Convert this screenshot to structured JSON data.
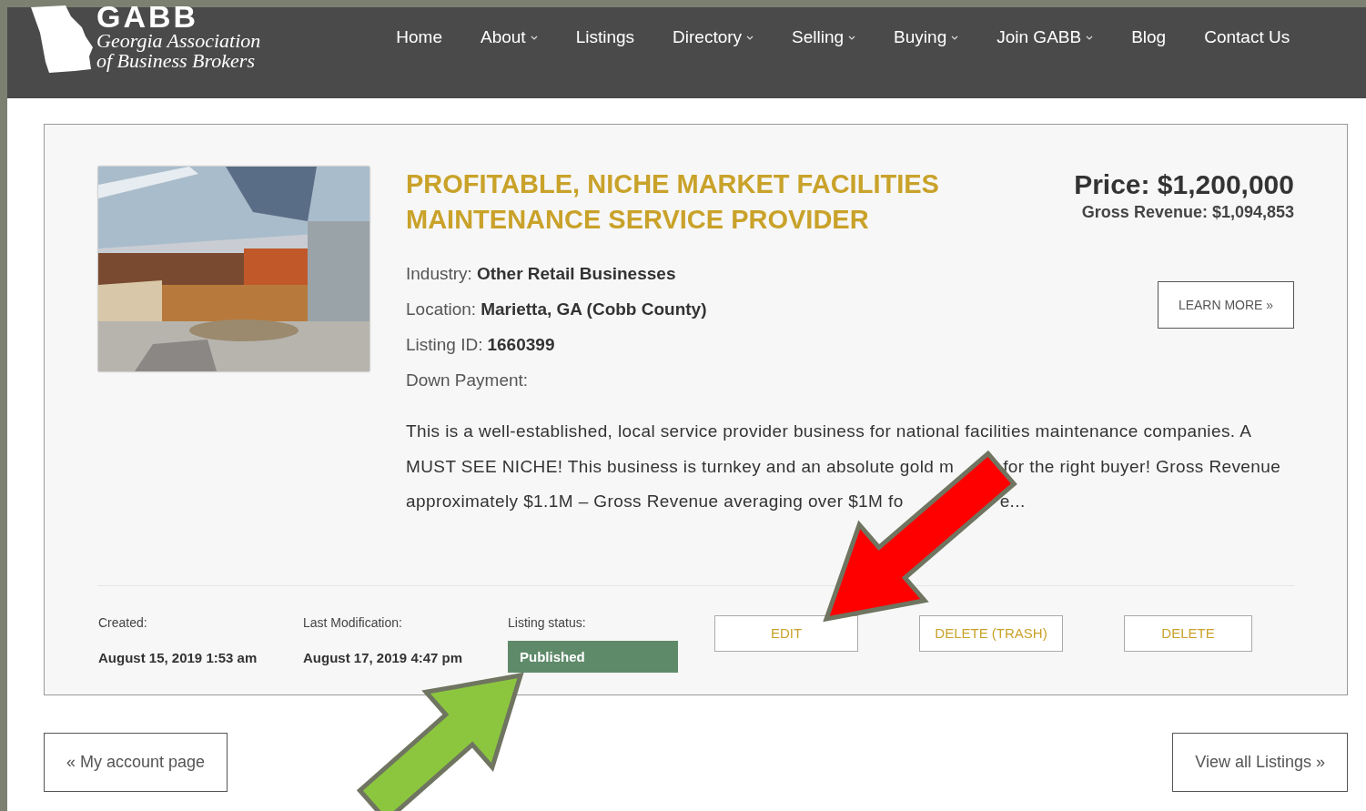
{
  "header": {
    "logo": {
      "title": "GABB",
      "subtitle_1": "Georgia Association",
      "subtitle_2": "of Business Brokers"
    },
    "nav": [
      {
        "label": "Home",
        "dropdown": false
      },
      {
        "label": "About",
        "dropdown": true
      },
      {
        "label": "Listings",
        "dropdown": false
      },
      {
        "label": "Directory",
        "dropdown": true
      },
      {
        "label": "Selling",
        "dropdown": true
      },
      {
        "label": "Buying",
        "dropdown": true
      },
      {
        "label": "Join GABB",
        "dropdown": true
      },
      {
        "label": "Blog",
        "dropdown": false
      },
      {
        "label": "Contact Us",
        "dropdown": false
      }
    ]
  },
  "listing": {
    "image": {
      "kind": "picture"
    },
    "title": "PROFITABLE, NICHE MARKET FACILITIES MAINTENANCE SERVICE PROVIDER",
    "price": "Price: $1,200,000",
    "gross_revenue": "Gross Revenue: $1,094,853",
    "learn_more": "LEARN MORE »",
    "details": [
      {
        "label": "Industry:",
        "value": "Other Retail Businesses"
      },
      {
        "label": "Location:",
        "value": "Marietta, GA (Cobb County)"
      },
      {
        "label": "Listing ID:",
        "value": "1660399"
      },
      {
        "label": "Down Payment:"
      }
    ],
    "description": [
      "This is a well-established, local service provider business for national facilities maintenance companies. A MUST SEE NICHE! This business is turnkey and an absolute gold m",
      "for the right buyer! Gross Revenue approximately $1.1M – Gross Revenue averaging over $1M fo",
      "e..."
    ],
    "meta": [
      {
        "label": "Created:",
        "value": "August 15, 2019 1:53 am"
      },
      {
        "label": "Last Modification:",
        "value": "August 17, 2019 4:47 pm"
      },
      {
        "label": "Listing status:",
        "status": "Published"
      }
    ],
    "actions": [
      "EDIT",
      "DELETE (TRASH)",
      "DELETE"
    ]
  },
  "footer_links": [
    "« My account page",
    "View all Listings »"
  ],
  "annotations": [
    {
      "kind": "arrow",
      "color": "#ff0000"
    },
    {
      "kind": "arrow",
      "color": "#8cc63f"
    }
  ]
}
